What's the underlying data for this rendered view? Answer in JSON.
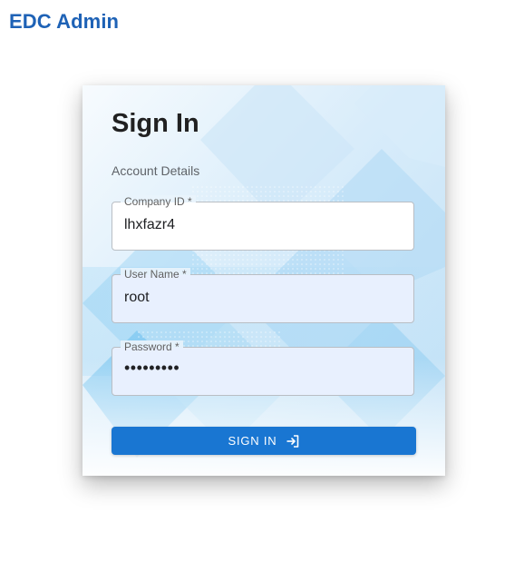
{
  "header": {
    "app_title": "EDC Admin"
  },
  "card": {
    "title": "Sign In",
    "section_label": "Account Details"
  },
  "form": {
    "company_id": {
      "label": "Company ID *",
      "value": "lhxfazr4"
    },
    "user_name": {
      "label": "User Name *",
      "value": "root"
    },
    "password": {
      "label": "Password *",
      "value": "•••••••••"
    },
    "submit": {
      "label": "SIGN IN",
      "icon": "login-icon"
    }
  },
  "colors": {
    "brand_title": "#1e62b6",
    "primary_button": "#1976d2",
    "autofill_background": "#e8f0fe"
  }
}
